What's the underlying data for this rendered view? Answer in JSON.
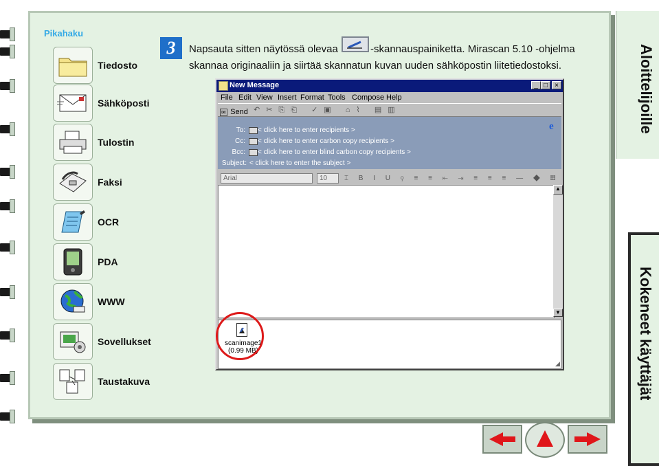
{
  "sidebar": {
    "title": "Pikahaku",
    "items": [
      {
        "label": "Tiedosto",
        "icon": "folder-icon"
      },
      {
        "label": "Sähköposti",
        "icon": "envelope-icon"
      },
      {
        "label": "Tulostin",
        "icon": "printer-icon"
      },
      {
        "label": "Faksi",
        "icon": "fax-icon"
      },
      {
        "label": "OCR",
        "icon": "notepad-icon"
      },
      {
        "label": "PDA",
        "icon": "pda-icon"
      },
      {
        "label": "WWW",
        "icon": "globe-icon"
      },
      {
        "label": "Sovellukset",
        "icon": "applications-icon"
      },
      {
        "label": "Taustakuva",
        "icon": "wallpaper-icon"
      }
    ]
  },
  "step": {
    "number": "3",
    "line1_before": "Napsauta sitten näytössä olevaa",
    "line1_after": "-skannauspainiketta. Mirascan 5.10 -ohjelma",
    "line2": "skannaa originaaliin ja siirtää skannatun kuvan uuden sähköpostin liitetiedostoksi."
  },
  "email_window": {
    "title": "New Message",
    "menu": [
      "File",
      "Edit",
      "View",
      "Insert",
      "Format",
      "Tools",
      "Compose",
      "Help"
    ],
    "send_label": "Send",
    "fields": [
      {
        "label": "To:",
        "value": "< click here to enter recipients >"
      },
      {
        "label": "Cc:",
        "value": "< click here to enter carbon copy recipients >"
      },
      {
        "label": "Bcc:",
        "value": "< click here to enter blind carbon copy recipients >"
      },
      {
        "label": "Subject:",
        "value": "< click here to enter the subject >"
      }
    ],
    "font_name": "Arial",
    "font_size": "10",
    "attachment": {
      "name": "scanimage1",
      "size": "(0.99 MB)"
    }
  },
  "tabs": {
    "beginners": "Aloittelijoille",
    "experienced": "Kokeneet käyttäjät"
  },
  "nav_buttons": [
    "previous-arrow-icon",
    "up-arrow-icon",
    "next-arrow-icon"
  ],
  "colors": {
    "accent": "#33a9e6",
    "page_bg": "#e4f2e3",
    "titlebar": "#0a1a7a",
    "nav_red": "#e0161a",
    "highlight_circle": "#dd1a1a"
  }
}
